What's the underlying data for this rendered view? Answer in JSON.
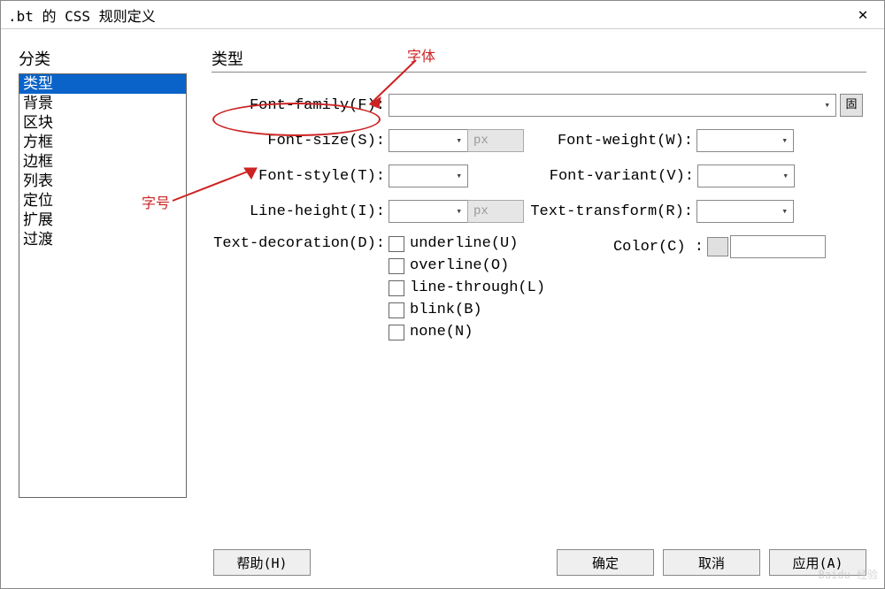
{
  "window": {
    "title": ".bt 的 CSS 规则定义",
    "close": "✕"
  },
  "left": {
    "header": "分类",
    "items": [
      "类型",
      "背景",
      "区块",
      "方框",
      "边框",
      "列表",
      "定位",
      "扩展",
      "过渡"
    ],
    "selected_index": 0
  },
  "right": {
    "header": "类型",
    "labels": {
      "font_family": "Font-family(F):",
      "font_size": "Font-size(S):",
      "font_weight": "Font-weight(W):",
      "font_style": "Font-style(T):",
      "font_variant": "Font-variant(V):",
      "line_height": "Line-height(I):",
      "text_transform": "Text-transform(R):",
      "text_decoration": "Text-decoration(D):",
      "color": "Color(C) :"
    },
    "units": {
      "px1": "px",
      "px2": "px"
    },
    "decorations": [
      "underline(U)",
      "overline(O)",
      "line-through(L)",
      "blink(B)",
      "none(N)"
    ],
    "icon_btn": "固"
  },
  "annotations": {
    "font": "字体",
    "size": "字号"
  },
  "buttons": {
    "help": "帮助(H)",
    "ok": "确定",
    "cancel": "取消",
    "apply": "应用(A)"
  }
}
